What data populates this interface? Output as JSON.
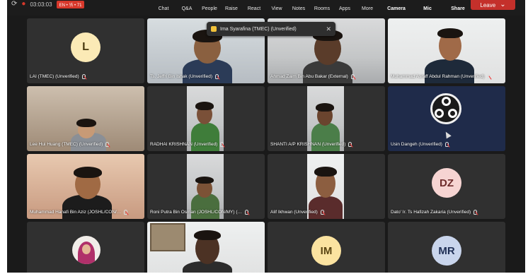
{
  "topbar": {
    "timer": "03:03:03",
    "rec_label": "EN • 卐 • 71",
    "buttons": [
      "Chat",
      "Q&A",
      "People",
      "Raise",
      "React",
      "View",
      "Notes",
      "Rooms",
      "Apps",
      "More",
      "Camera",
      "Mic",
      "Share"
    ],
    "leave_label": "Leave"
  },
  "notification": {
    "text": "Ima Syarafina (TMEC) (Unverified)"
  },
  "participants": [
    {
      "name": "LAI (TMEC) (Unverified)",
      "initials": "L",
      "avatar_color": "#fbeab6"
    },
    {
      "name": "Ts. Jeffri Bin Ishak (Unverified)"
    },
    {
      "name": "Ahmad Zaim Bin Abu Bakar (External)"
    },
    {
      "name": "Muhammad Asraff Abdul Rahman (Unverified)"
    },
    {
      "name": "Lee Hui Huang (TMEC) (Unverified)"
    },
    {
      "name": "RADHAI KRISHNAN (Unverified)"
    },
    {
      "name": "SHANTI A/P KRISHNAN (Unverified)"
    },
    {
      "name": "Usin Dangeh (Unverified)"
    },
    {
      "name": "Muhammad Hanafi Bin Aziz (JOSHL/CON/…"
    },
    {
      "name": "Roni Putra Bin Osman (JOSHL/CON/MY) (…"
    },
    {
      "name": "Alif Ikhwan (Unverified)"
    },
    {
      "name": "Dato' Ir. Ts Hafizah Zakaria (Unverified)",
      "initials": "DZ",
      "avatar_color": "#f6d4d2"
    },
    {
      "name": "",
      "initials": ""
    },
    {
      "name": ""
    },
    {
      "name": "",
      "initials": "IM",
      "avatar_color": "#fbe3a0"
    },
    {
      "name": "",
      "initials": "MR",
      "avatar_color": "#c9d5ec"
    }
  ],
  "icons": [
    "mic-muted-icon",
    "raised-hand-icon",
    "close-icon",
    "obs-logo-icon"
  ]
}
